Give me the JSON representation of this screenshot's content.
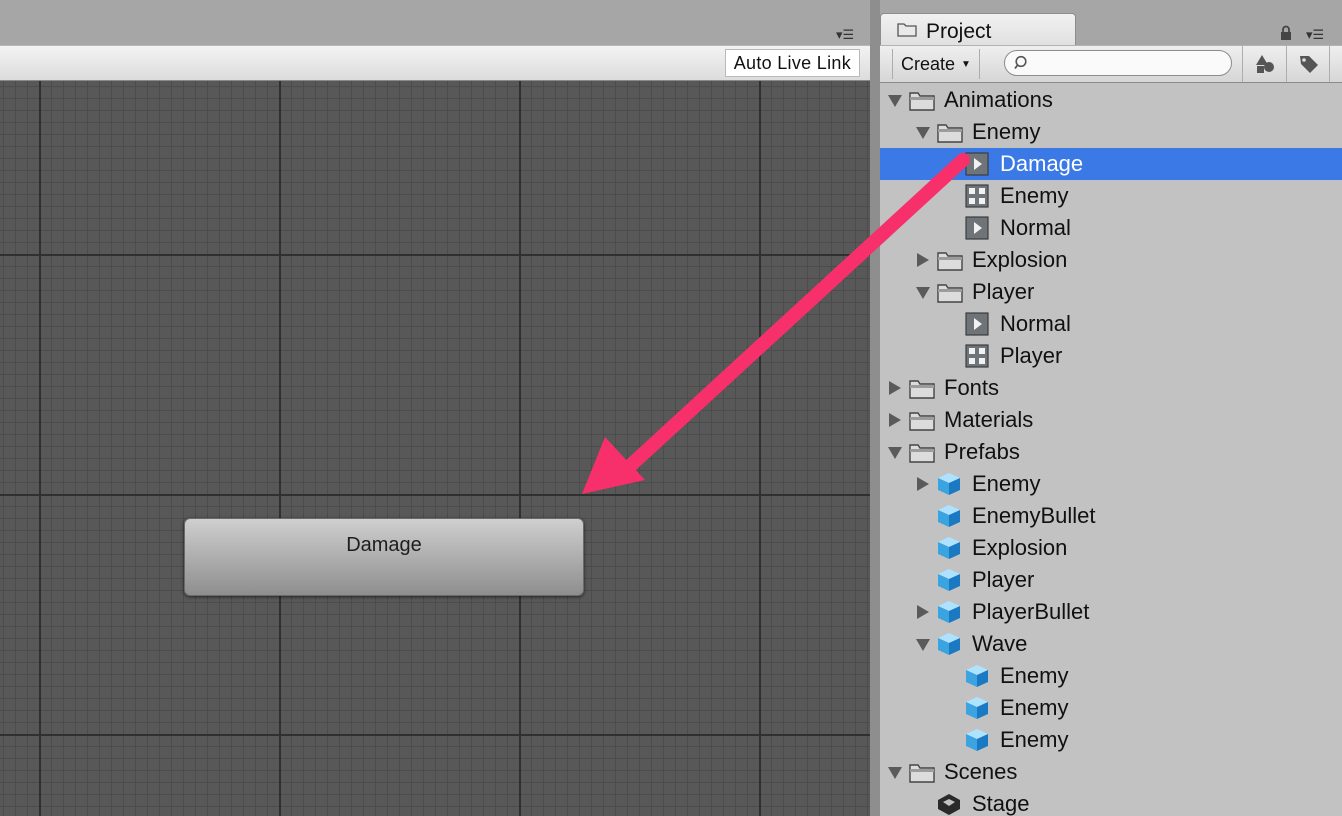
{
  "animator": {
    "toolbar": {
      "auto_live_link_label": "Auto Live Link"
    },
    "state_node": {
      "label": "Damage"
    },
    "menu_glyph": "▾☰"
  },
  "project": {
    "tab_label": "Project",
    "menu_glyph": "▾☰",
    "toolbar": {
      "create_label": "Create",
      "create_caret": "▼",
      "search_placeholder": "",
      "search_value": ""
    },
    "tree": [
      {
        "label": "Animations",
        "type": "folder",
        "depth": 0,
        "fold": "open",
        "selected": false
      },
      {
        "label": "Enemy",
        "type": "folder",
        "depth": 1,
        "fold": "open",
        "selected": false
      },
      {
        "label": "Damage",
        "type": "animation-clip",
        "depth": 2,
        "fold": "none",
        "selected": true
      },
      {
        "label": "Enemy",
        "type": "animator-controller",
        "depth": 2,
        "fold": "none",
        "selected": false
      },
      {
        "label": "Normal",
        "type": "animation-clip",
        "depth": 2,
        "fold": "none",
        "selected": false
      },
      {
        "label": "Explosion",
        "type": "folder",
        "depth": 1,
        "fold": "closed",
        "selected": false
      },
      {
        "label": "Player",
        "type": "folder",
        "depth": 1,
        "fold": "open",
        "selected": false
      },
      {
        "label": "Normal",
        "type": "animation-clip",
        "depth": 2,
        "fold": "none",
        "selected": false
      },
      {
        "label": "Player",
        "type": "animator-controller",
        "depth": 2,
        "fold": "none",
        "selected": false
      },
      {
        "label": "Fonts",
        "type": "folder",
        "depth": 0,
        "fold": "closed",
        "selected": false
      },
      {
        "label": "Materials",
        "type": "folder",
        "depth": 0,
        "fold": "closed",
        "selected": false
      },
      {
        "label": "Prefabs",
        "type": "folder",
        "depth": 0,
        "fold": "open",
        "selected": false
      },
      {
        "label": "Enemy",
        "type": "prefab",
        "depth": 1,
        "fold": "closed",
        "selected": false
      },
      {
        "label": "EnemyBullet",
        "type": "prefab",
        "depth": 1,
        "fold": "none",
        "selected": false
      },
      {
        "label": "Explosion",
        "type": "prefab",
        "depth": 1,
        "fold": "none",
        "selected": false
      },
      {
        "label": "Player",
        "type": "prefab",
        "depth": 1,
        "fold": "none",
        "selected": false
      },
      {
        "label": "PlayerBullet",
        "type": "prefab",
        "depth": 1,
        "fold": "closed",
        "selected": false
      },
      {
        "label": "Wave",
        "type": "prefab",
        "depth": 1,
        "fold": "open",
        "selected": false
      },
      {
        "label": "Enemy",
        "type": "prefab",
        "depth": 2,
        "fold": "none",
        "selected": false
      },
      {
        "label": "Enemy",
        "type": "prefab",
        "depth": 2,
        "fold": "none",
        "selected": false
      },
      {
        "label": "Enemy",
        "type": "prefab",
        "depth": 2,
        "fold": "none",
        "selected": false
      },
      {
        "label": "Scenes",
        "type": "folder",
        "depth": 0,
        "fold": "open",
        "selected": false
      },
      {
        "label": "Stage",
        "type": "scene",
        "depth": 1,
        "fold": "none",
        "selected": false
      }
    ]
  },
  "colors": {
    "selection": "#3a79e6",
    "annotation_arrow": "#f7306b",
    "grid_background": "#585858"
  }
}
